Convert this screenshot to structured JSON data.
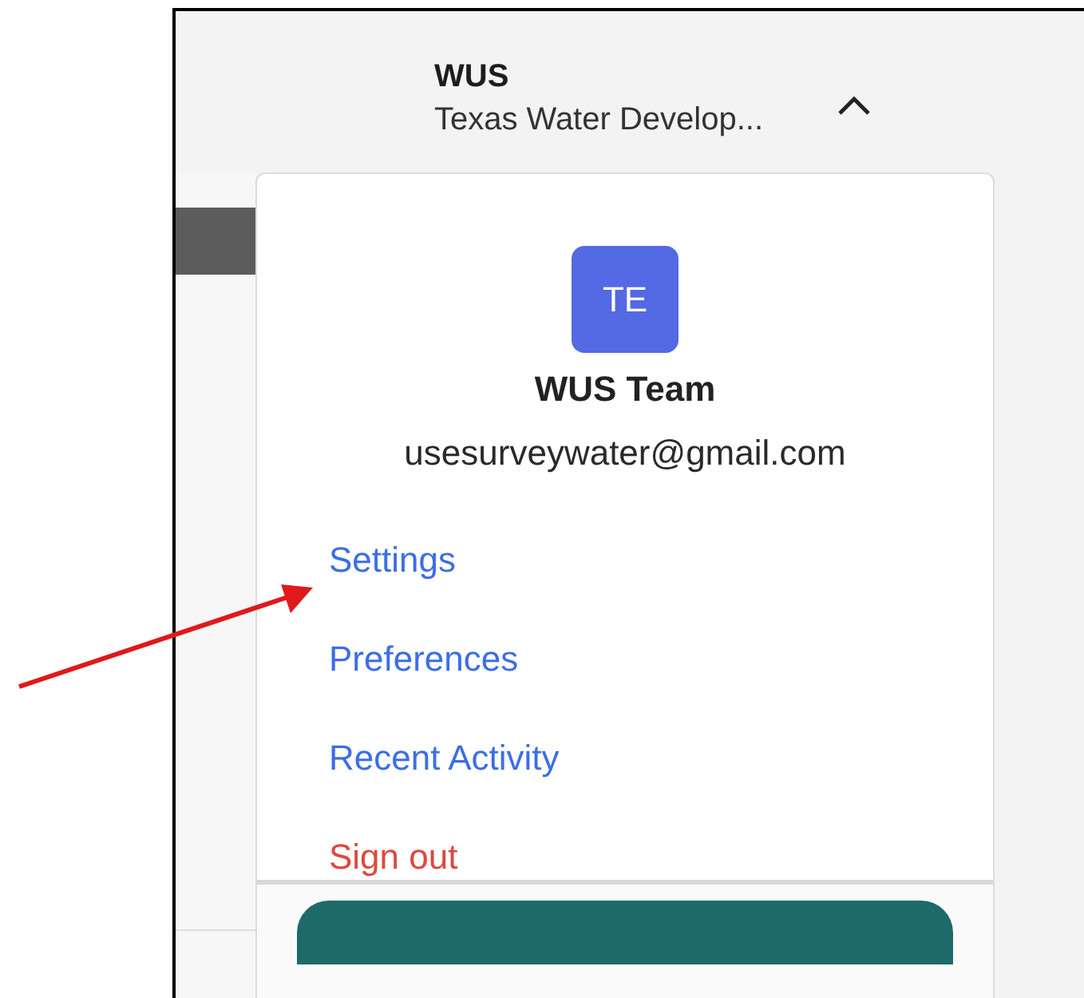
{
  "header": {
    "title": "WUS",
    "subtitle": "Texas Water Develop...",
    "expanded": true
  },
  "account_menu": {
    "avatar_initials": "TE",
    "name": "WUS Team",
    "email": "usesurveywater@gmail.com",
    "items": [
      {
        "label": "Settings",
        "kind": "link"
      },
      {
        "label": "Preferences",
        "kind": "link"
      },
      {
        "label": "Recent Activity",
        "kind": "link"
      },
      {
        "label": "Sign out",
        "kind": "danger"
      }
    ]
  }
}
